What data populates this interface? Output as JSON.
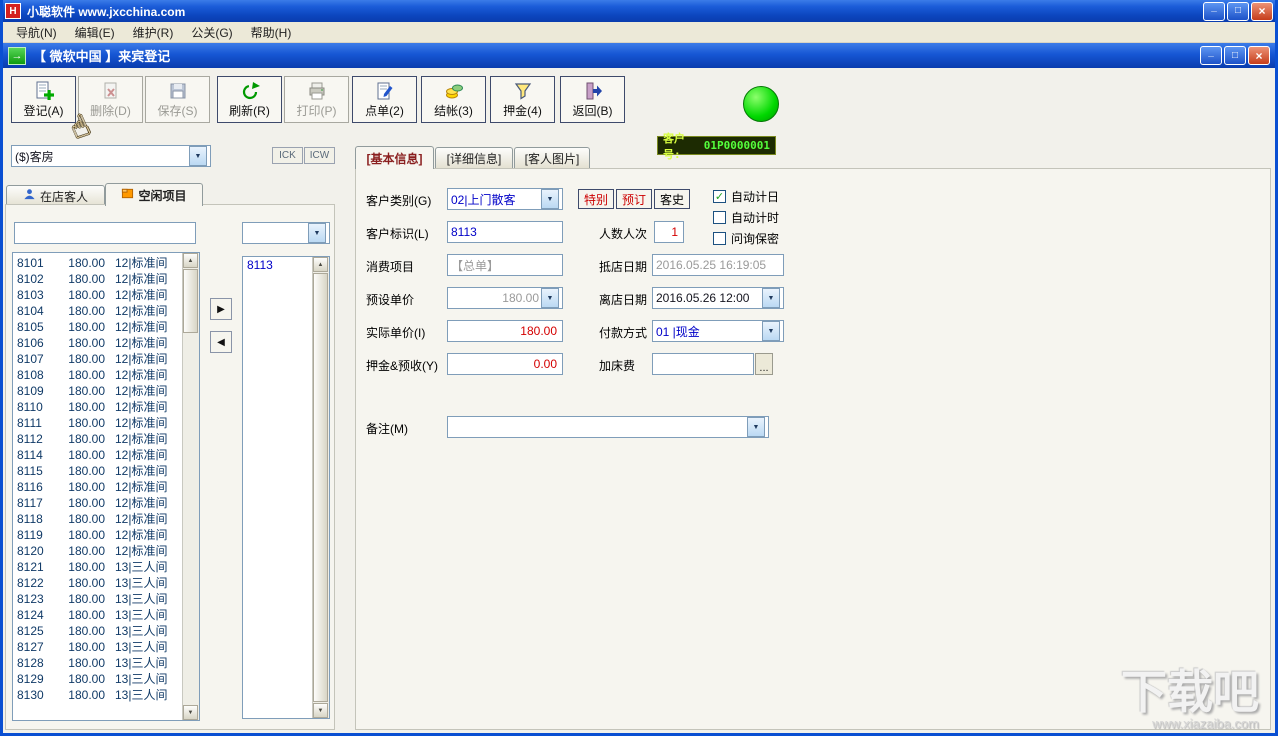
{
  "window": {
    "logo_text": "H",
    "title": "小聪软件 www.jxcchina.com"
  },
  "menu": {
    "items": [
      "导航(N)",
      "编辑(E)",
      "维护(R)",
      "公关(G)",
      "帮助(H)"
    ]
  },
  "doc_window": {
    "title": "【 微软中国 】来宾登记"
  },
  "toolbar": {
    "buttons": [
      {
        "label": "登记(A)",
        "enabled": true
      },
      {
        "label": "删除(D)",
        "enabled": false
      },
      {
        "label": "保存(S)",
        "enabled": false
      },
      {
        "label": "刷新(R)",
        "enabled": true
      },
      {
        "label": "打印(P)",
        "enabled": false
      },
      {
        "label": "点单(2)",
        "enabled": true
      },
      {
        "label": "结帐(3)",
        "enabled": true
      },
      {
        "label": "押金(4)",
        "enabled": true
      },
      {
        "label": "返回(B)",
        "enabled": true
      }
    ]
  },
  "led": {
    "label": "客户号:",
    "value": "01P0000001"
  },
  "left": {
    "category_value": "($)客房",
    "ick_label": "ICK",
    "icw_label": "ICW",
    "tab_instore": "在店客人",
    "tab_idle": "空闲项目",
    "search_value": "",
    "filter_value": "",
    "selected_room": "8113",
    "rooms": [
      {
        "no": "8101",
        "price": "180.00",
        "type": "12|标准间"
      },
      {
        "no": "8102",
        "price": "180.00",
        "type": "12|标准间"
      },
      {
        "no": "8103",
        "price": "180.00",
        "type": "12|标准间"
      },
      {
        "no": "8104",
        "price": "180.00",
        "type": "12|标准间"
      },
      {
        "no": "8105",
        "price": "180.00",
        "type": "12|标准间"
      },
      {
        "no": "8106",
        "price": "180.00",
        "type": "12|标准间"
      },
      {
        "no": "8107",
        "price": "180.00",
        "type": "12|标准间"
      },
      {
        "no": "8108",
        "price": "180.00",
        "type": "12|标准间"
      },
      {
        "no": "8109",
        "price": "180.00",
        "type": "12|标准间"
      },
      {
        "no": "8110",
        "price": "180.00",
        "type": "12|标准间"
      },
      {
        "no": "8111",
        "price": "180.00",
        "type": "12|标准间"
      },
      {
        "no": "8112",
        "price": "180.00",
        "type": "12|标准间"
      },
      {
        "no": "8114",
        "price": "180.00",
        "type": "12|标准间"
      },
      {
        "no": "8115",
        "price": "180.00",
        "type": "12|标准间"
      },
      {
        "no": "8116",
        "price": "180.00",
        "type": "12|标准间"
      },
      {
        "no": "8117",
        "price": "180.00",
        "type": "12|标准间"
      },
      {
        "no": "8118",
        "price": "180.00",
        "type": "12|标准间"
      },
      {
        "no": "8119",
        "price": "180.00",
        "type": "12|标准间"
      },
      {
        "no": "8120",
        "price": "180.00",
        "type": "12|标准间"
      },
      {
        "no": "8121",
        "price": "180.00",
        "type": "13|三人间"
      },
      {
        "no": "8122",
        "price": "180.00",
        "type": "13|三人间"
      },
      {
        "no": "8123",
        "price": "180.00",
        "type": "13|三人间"
      },
      {
        "no": "8124",
        "price": "180.00",
        "type": "13|三人间"
      },
      {
        "no": "8125",
        "price": "180.00",
        "type": "13|三人间"
      },
      {
        "no": "8127",
        "price": "180.00",
        "type": "13|三人间"
      },
      {
        "no": "8128",
        "price": "180.00",
        "type": "13|三人间"
      },
      {
        "no": "8129",
        "price": "180.00",
        "type": "13|三人间"
      },
      {
        "no": "8130",
        "price": "180.00",
        "type": "13|三人间"
      }
    ]
  },
  "form": {
    "tab_basic": "[基本信息]",
    "tab_detail": "[详细信息]",
    "tab_photo": "[客人图片]",
    "customer_type_label": "客户类别(G)",
    "customer_type_value": "02|上门散客",
    "special_button": "特别",
    "reserve_button": "预订",
    "history_button": "客史",
    "checkboxes": [
      {
        "label": "自动计日",
        "checked": true
      },
      {
        "label": "自动计时",
        "checked": false
      },
      {
        "label": "问询保密",
        "checked": false
      }
    ],
    "customer_id_label": "客户标识(L)",
    "customer_id_value": "8113",
    "people_label": "人数人次",
    "people_value": "1",
    "consume_label": "消费项目",
    "consume_value": "【总单】",
    "arrive_label": "抵店日期",
    "arrive_value": "2016.05.25 16:19:05",
    "preset_price_label": "预设单价",
    "preset_price_value": "180.00",
    "depart_label": "离店日期",
    "depart_value": "2016.05.26 12:00",
    "actual_price_label": "实际单价(I)",
    "actual_price_value": "180.00",
    "payment_label": "付款方式",
    "payment_value": "01 |现金",
    "deposit_label": "押金&预收(Y)",
    "deposit_value": "0.00",
    "bed_fee_label": "加床费",
    "bed_fee_value": "",
    "bed_fee_browse": "...",
    "remark_label": "备注(M)",
    "remark_value": ""
  },
  "icons": {
    "hand": "☝",
    "transfer_right": "▶",
    "transfer_left": "◀"
  },
  "watermark": {
    "title": "下载吧",
    "url": "www.xiazaiba.com"
  }
}
